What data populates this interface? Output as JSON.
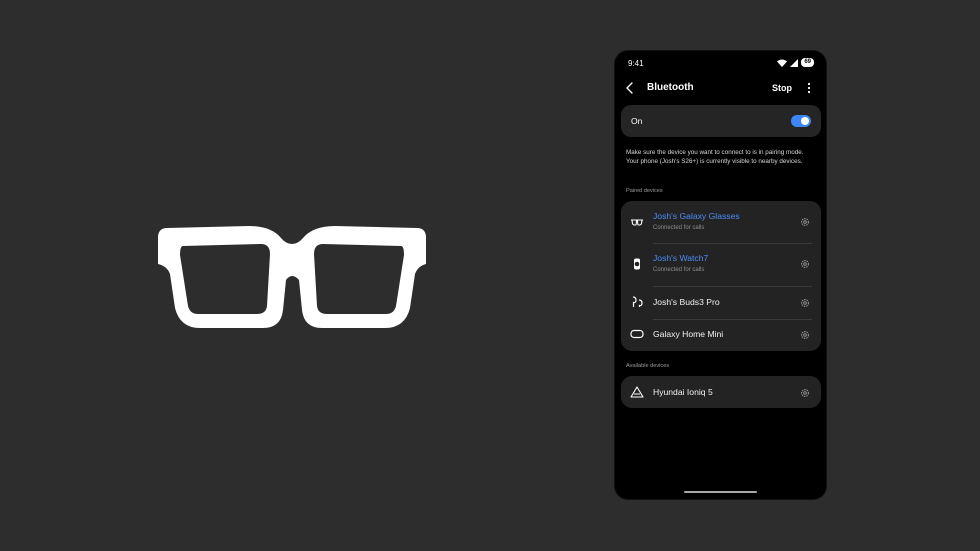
{
  "status_bar": {
    "time": "9:41",
    "battery": "69"
  },
  "header": {
    "title": "Bluetooth",
    "stop_label": "Stop"
  },
  "toggle": {
    "label": "On",
    "enabled": true
  },
  "note": "Make sure the device you want to connect to is in pairing mode. Your phone (Josh's S26+) is currently visible to nearby devices.",
  "paired": {
    "heading": "Paired devices",
    "devices": [
      {
        "name": "Josh's Galaxy Glasses",
        "status": "Connected for calls",
        "icon": "glasses-icon"
      },
      {
        "name": "Josh's Watch7",
        "status": "Connected for calls",
        "icon": "watch-icon"
      },
      {
        "name": "Josh's Buds3 Pro",
        "icon": "earbuds-icon"
      },
      {
        "name": "Galaxy Home Mini",
        "icon": "speaker-icon"
      }
    ]
  },
  "available": {
    "heading": "Available devices",
    "devices": [
      {
        "name": "Hyundai Ioniq 5",
        "icon": "car-icon"
      }
    ]
  },
  "colors": {
    "accent": "#3e86f5",
    "connected_text": "#4d8df5",
    "background": "#2d2d2e",
    "card": "#232324"
  }
}
